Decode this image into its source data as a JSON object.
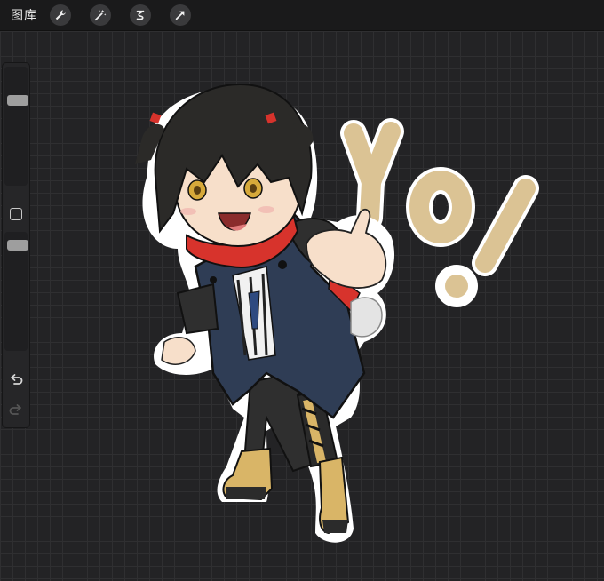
{
  "topbar": {
    "gallery_label": "图库",
    "tools": [
      {
        "name": "actions-wrench-icon"
      },
      {
        "name": "adjustments-magic-wand-icon"
      },
      {
        "name": "selection-icon"
      },
      {
        "name": "transform-arrow-icon"
      }
    ]
  },
  "sidebar": {
    "brush_size_level": 0.74,
    "opacity_level": 0.93,
    "undo_icon": "undo-icon",
    "redo_icon": "redo-icon"
  },
  "artwork": {
    "lettering": "YO!",
    "colors": {
      "lettering": "#dbc394",
      "hair": "#2b2a28",
      "coat": "#2f3d55",
      "scarf": "#d7332c",
      "skin": "#f7dfca",
      "boots": "#d9b567",
      "outline": "#ffffff"
    }
  }
}
